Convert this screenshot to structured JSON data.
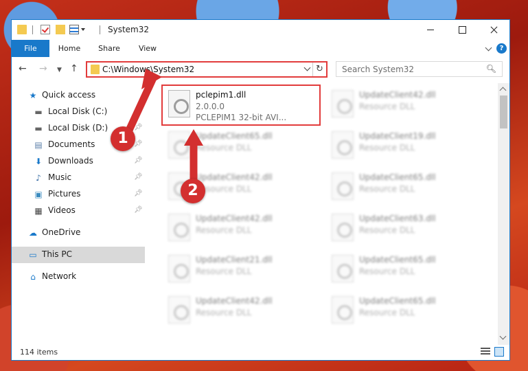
{
  "window": {
    "title": "System32"
  },
  "ribbon": {
    "tabs": [
      "File",
      "Home",
      "Share",
      "View"
    ]
  },
  "address": {
    "path": "C:\\Windows\\System32"
  },
  "search": {
    "placeholder": "Search System32"
  },
  "sidebar": {
    "items": [
      {
        "label": "Quick access",
        "icon": "star-icon"
      },
      {
        "label": "Local Disk (C:)",
        "icon": "drive-icon"
      },
      {
        "label": "Local Disk (D:)",
        "icon": "drive-icon"
      },
      {
        "label": "Documents",
        "icon": "documents-icon"
      },
      {
        "label": "Downloads",
        "icon": "downloads-icon"
      },
      {
        "label": "Music",
        "icon": "music-icon"
      },
      {
        "label": "Pictures",
        "icon": "pictures-icon"
      },
      {
        "label": "Videos",
        "icon": "videos-icon"
      },
      {
        "label": "OneDrive",
        "icon": "cloud-icon"
      },
      {
        "label": "This PC",
        "icon": "computer-icon"
      },
      {
        "label": "Network",
        "icon": "network-icon"
      }
    ]
  },
  "files": {
    "highlighted": {
      "name": "pclepim1.dll",
      "version": "2.0.0.0",
      "description": "PCLEPIM1 32-bit AVI..."
    },
    "others": [
      {
        "name": "UpdateClient42.dll",
        "type": "Resource DLL"
      },
      {
        "name": "UpdateClient65.dll",
        "type": "Resource DLL"
      },
      {
        "name": "UpdateClient19.dll",
        "type": "Resource DLL"
      },
      {
        "name": "UpdateClient42.dll",
        "type": "Resource DLL"
      },
      {
        "name": "UpdateClient65.dll",
        "type": "Resource DLL"
      },
      {
        "name": "UpdateClient42.dll",
        "type": "Resource DLL"
      },
      {
        "name": "UpdateClient63.dll",
        "type": "Resource DLL"
      },
      {
        "name": "UpdateClient21.dll",
        "type": "Resource DLL"
      },
      {
        "name": "UpdateClient65.dll",
        "type": "Resource DLL"
      },
      {
        "name": "UpdateClient42.dll",
        "type": "Resource DLL"
      },
      {
        "name": "UpdateClient65.dll",
        "type": "Resource DLL"
      }
    ]
  },
  "status": {
    "item_count": "114 items"
  },
  "annotations": {
    "step1": "1",
    "step2": "2",
    "color": "#d32f2f"
  }
}
